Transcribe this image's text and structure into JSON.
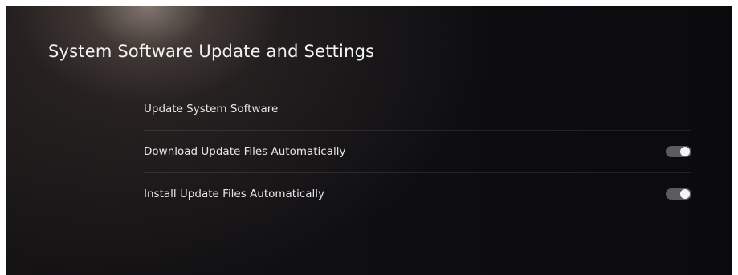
{
  "page": {
    "title": "System Software Update and Settings"
  },
  "settings": {
    "items": [
      {
        "label": "Update System Software"
      },
      {
        "label": "Download Update Files Automatically",
        "toggle": "on"
      },
      {
        "label": "Install Update Files Automatically",
        "toggle": "on"
      }
    ]
  },
  "colors": {
    "text": "#f2f2f2",
    "toggle_track": "#5c5c60",
    "toggle_knob": "#f4f4f4"
  }
}
